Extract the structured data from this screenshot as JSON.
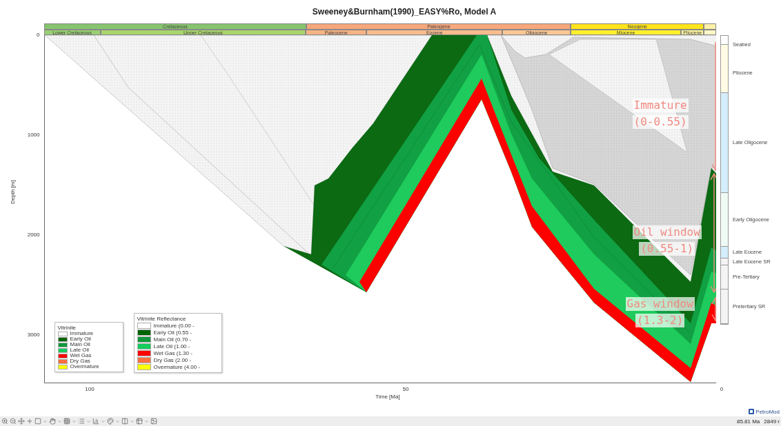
{
  "title": "Sweeney&Burnham(1990)_EASY%Ro, Model A",
  "timescale": {
    "periods": [
      {
        "label": "Cretaceous",
        "color": "#86c46e"
      },
      {
        "label": "Paleogene",
        "color": "#f6a77b"
      },
      {
        "label": "Neogene",
        "color": "#ffe41c"
      },
      {
        "color": "#fdf1a8"
      }
    ],
    "epochs": [
      {
        "label": "Lower Cretaceous",
        "color": "#99cf72"
      },
      {
        "label": "Upper Cretaceous",
        "color": "#a9d56c"
      },
      {
        "label": "Paleocene",
        "color": "#f8b384"
      },
      {
        "label": "Eocene",
        "color": "#f9bb8c"
      },
      {
        "label": "Oligocene",
        "color": "#fcc794"
      },
      {
        "label": "Miocene",
        "color": "#fff02c"
      },
      {
        "label": "Pliocene",
        "color": "#fff5a0"
      },
      {
        "color": "#fff6c8"
      }
    ]
  },
  "axes": {
    "ylabel": "Depth [m]",
    "yticks": [
      "0",
      "1000",
      "2000",
      "3000"
    ],
    "xlabel": "Time [Ma]",
    "xticks": [
      "100",
      "50",
      "0"
    ]
  },
  "legends": [
    {
      "title": "Vitrinite",
      "items": [
        {
          "label": "Immature",
          "color": "#ffffff"
        },
        {
          "label": "Early Oil",
          "color": "#006400"
        },
        {
          "label": "Main Oil",
          "color": "#109a3c"
        },
        {
          "label": "Late Oil",
          "color": "#16cc5e"
        },
        {
          "label": "Wet Gas",
          "color": "#ff0000"
        },
        {
          "label": "Dry Gas",
          "color": "#ff6f3f"
        },
        {
          "label": "Overmature",
          "color": "#ffff00"
        }
      ]
    },
    {
      "title": "Vitrinite Reflectance",
      "items": [
        {
          "label": "Immature (0.00 -",
          "color": "#ffffff"
        },
        {
          "label": "Early Oil (0.55 -",
          "color": "#006400"
        },
        {
          "label": "Main Oil (0.70 -",
          "color": "#109a3c"
        },
        {
          "label": "Late Oil (1.00 -",
          "color": "#16cc5e"
        },
        {
          "label": "Wet Gas (1.30 -",
          "color": "#ff0000"
        },
        {
          "label": "Dry Gas (2.00 -",
          "color": "#ff6f3f"
        },
        {
          "label": "Overmature (4.00 -",
          "color": "#ffff00"
        }
      ]
    }
  ],
  "annotations": [
    {
      "label": "Immature",
      "range": "(0-0.55)"
    },
    {
      "label": "Oil window",
      "range": "(0.55-1)"
    },
    {
      "label": "Gas window",
      "range": "(1.3-2)"
    }
  ],
  "stratigraphy": {
    "marker": "Seabed",
    "layers": [
      {
        "label": "Pliocene",
        "color": "#fffbe4"
      },
      {
        "label": "Late Oligocene",
        "color": "#d4eefb"
      },
      {
        "label": "Early Oligocene",
        "color": "#f0faf4"
      },
      {
        "label": "Late Eocene",
        "color": "#d4eefb"
      },
      {
        "label": "Late Eocene SR",
        "color": "#f4f4f4"
      },
      {
        "label": "Pre-Tertiary",
        "color": "#f4f4f4"
      },
      {
        "label": "Pretertiary SR",
        "color": "#f4f4f4"
      }
    ]
  },
  "logo": "PetroMod",
  "status_bar": {
    "time": "85.81 Ma",
    "depth": "2849 r"
  }
}
